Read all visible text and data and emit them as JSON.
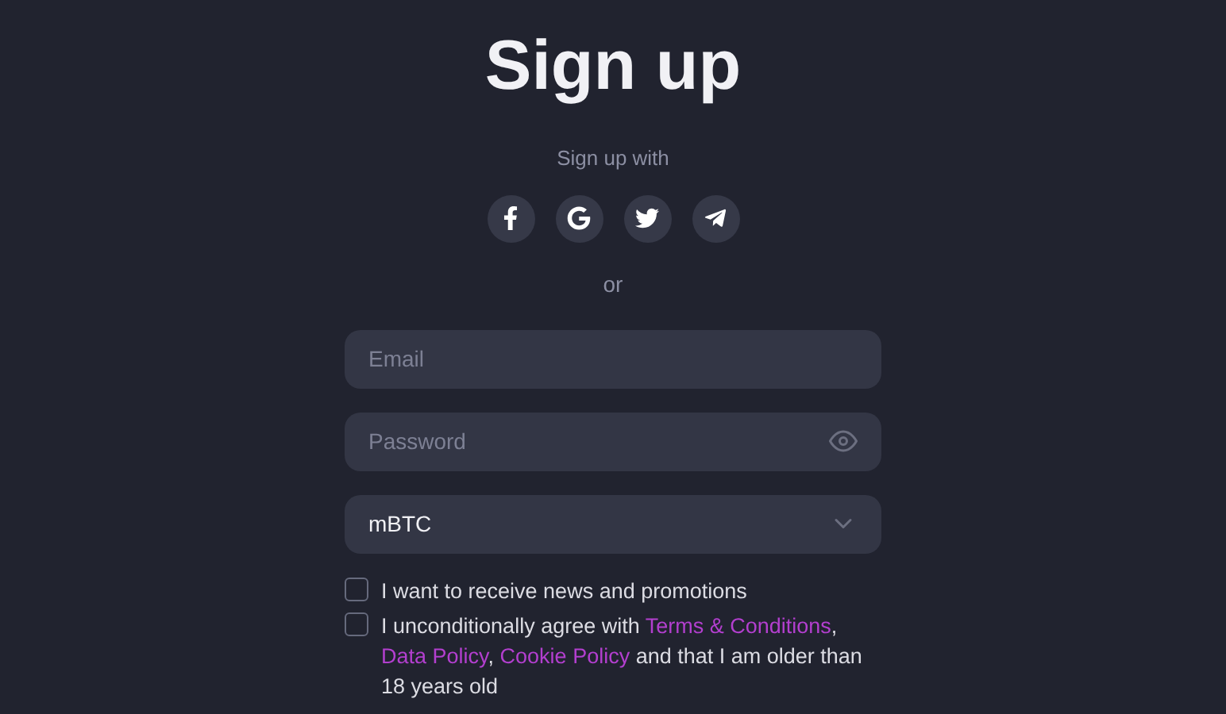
{
  "title": "Sign up",
  "social": {
    "label": "Sign up with",
    "buttons": [
      {
        "kind": "facebook"
      },
      {
        "kind": "google"
      },
      {
        "kind": "twitter"
      },
      {
        "kind": "telegram"
      }
    ]
  },
  "separator": "or",
  "fields": [
    {
      "kind": "text",
      "placeholder": "Email"
    },
    {
      "kind": "password",
      "placeholder": "Password"
    },
    {
      "kind": "select",
      "value": "mBTC"
    }
  ],
  "consents": [
    {
      "checked": false,
      "segments": [
        {
          "kind": "text",
          "text": "I want to receive news and promotions"
        }
      ]
    },
    {
      "checked": false,
      "segments": [
        {
          "kind": "text",
          "text": "I unconditionally agree with "
        },
        {
          "kind": "link",
          "text": "Terms & Conditions"
        },
        {
          "kind": "text",
          "text": ", "
        },
        {
          "kind": "link",
          "text": "Data Policy"
        },
        {
          "kind": "text",
          "text": ", "
        },
        {
          "kind": "link",
          "text": "Cookie Policy"
        },
        {
          "kind": "text",
          "text": " and that I am older than 18 years old"
        }
      ]
    }
  ]
}
